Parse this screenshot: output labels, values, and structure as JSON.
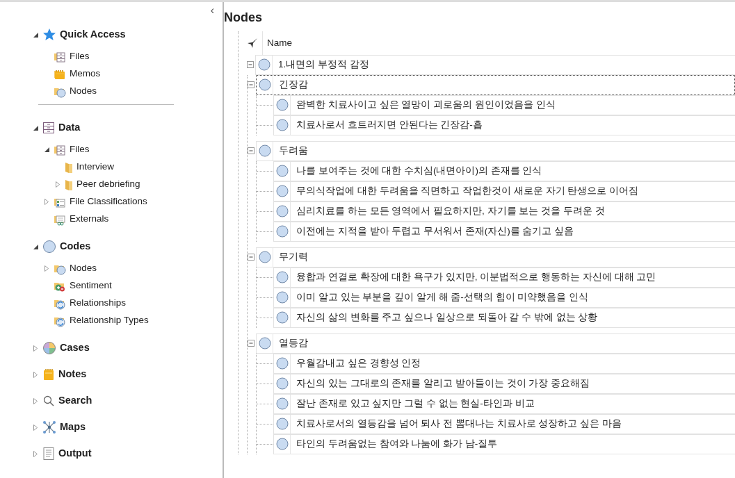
{
  "sidebar": {
    "collapse_glyph": "‹",
    "sections": [
      {
        "label": "Quick Access",
        "kind": "star",
        "expanded": true,
        "divider_after": true,
        "children": [
          {
            "label": "Files",
            "kind": "cabinet-folder"
          },
          {
            "label": "Memos",
            "kind": "memo-folder"
          },
          {
            "label": "Nodes",
            "kind": "node-folder"
          }
        ]
      },
      {
        "label": "Data",
        "kind": "cabinet",
        "expanded": true,
        "divider_after": false,
        "children": [
          {
            "label": "Files",
            "kind": "cabinet-folder",
            "expanded": true,
            "children": [
              {
                "label": "Interview",
                "kind": "folder"
              },
              {
                "label": "Peer debriefing",
                "kind": "folder",
                "expanded": false
              }
            ]
          },
          {
            "label": "File Classifications",
            "kind": "classification",
            "expanded": false
          },
          {
            "label": "Externals",
            "kind": "externals"
          }
        ]
      },
      {
        "label": "Codes",
        "kind": "circle",
        "expanded": true,
        "divider_after": false,
        "children": [
          {
            "label": "Nodes",
            "kind": "node-folder",
            "expanded": false
          },
          {
            "label": "Sentiment",
            "kind": "sentiment"
          },
          {
            "label": "Relationships",
            "kind": "relationship"
          },
          {
            "label": "Relationship Types",
            "kind": "relationship"
          }
        ]
      },
      {
        "label": "Cases",
        "kind": "pie",
        "expanded": false,
        "divider_after": false
      },
      {
        "label": "Notes",
        "kind": "notebook",
        "expanded": false,
        "divider_after": false
      },
      {
        "label": "Search",
        "kind": "search",
        "expanded": false,
        "divider_after": false
      },
      {
        "label": "Maps",
        "kind": "map",
        "expanded": false,
        "divider_after": false
      },
      {
        "label": "Output",
        "kind": "document",
        "expanded": false,
        "divider_after": false
      }
    ]
  },
  "main": {
    "title": "Nodes",
    "column": "Name",
    "nodes": [
      {
        "label": "1.내면의 부정적 감정",
        "expanded": true,
        "focused": false,
        "children": [
          {
            "label": "긴장감",
            "expanded": true,
            "focused": true,
            "children": [
              {
                "label": "완벽한 치료사이고 싶은 열망이 괴로움의 원인이었음을 인식",
                "focused": false
              },
              {
                "label": "치료사로서 흐트러지면 안된다는 긴장감-흡",
                "focused": false
              }
            ]
          },
          {
            "label": "두려움",
            "expanded": true,
            "focused": false,
            "children": [
              {
                "label": "나를 보여주는 것에 대한 수치심(내면아이)의 존재를 인식",
                "focused": false
              },
              {
                "label": "무의식작업에 대한 두려움을 직면하고 작업한것이 새로운 자기 탄생으로 이어짐",
                "focused": false
              },
              {
                "label": "심리치료를 하는 모든 영역에서 필요하지만, 자기를 보는 것을 두려운 것",
                "focused": false
              },
              {
                "label": "이전에는 지적을 받아 두렵고 무서워서 존재(자신)를 숨기고 싶음",
                "focused": false
              }
            ]
          },
          {
            "label": "무기력",
            "expanded": true,
            "focused": false,
            "children": [
              {
                "label": "융합과 연결로 확장에 대한 욕구가 있지만, 이분법적으로 행동하는 자신에 대해 고민",
                "focused": false
              },
              {
                "label": "이미 알고 있는 부분을 깊이 알게 해 줌-선택의 힘이 미약했음을 인식",
                "focused": false
              },
              {
                "label": "자신의 삶의 변화를 주고 싶으나 일상으로 되돌아 갈 수 밖에 없는 상황",
                "focused": false
              }
            ]
          },
          {
            "label": "열등감",
            "expanded": true,
            "focused": false,
            "children": [
              {
                "label": "우월감내고 싶은 경향성 인정",
                "focused": false
              },
              {
                "label": "자신의 있는 그대로의 존재를 알리고 받아들이는 것이 가장 중요해짐",
                "focused": false
              },
              {
                "label": "잘난 존재로 있고 싶지만 그럴 수 없는 현실-타인과 비교",
                "focused": false
              },
              {
                "label": "치료사로서의 열등감을 넘어 퇴사 전 뽐대나는 치료사로 성장하고 싶은 마음",
                "focused": false
              },
              {
                "label": "타인의 두려움없는 참여와 나눔에 화가 남-질투",
                "focused": false
              }
            ]
          }
        ]
      }
    ]
  }
}
